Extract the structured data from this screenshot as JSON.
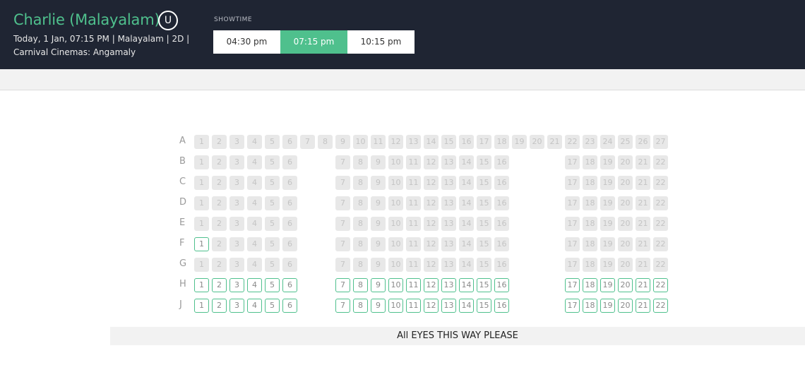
{
  "header": {
    "title": "Charlie (Malayalam)",
    "certificate": "U",
    "info_line1": "Today, 1 Jan, 07:15 PM | Malayalam | 2D |",
    "info_line2": "Carnival Cinemas: Angamaly"
  },
  "showtimes": {
    "label": "SHOWTIME",
    "times": [
      "04:30 pm",
      "07:15 pm",
      "10:15 pm"
    ],
    "selected": "07:15 pm"
  },
  "seating": {
    "rows": [
      {
        "label": "A",
        "seats": [
          {
            "n": "1",
            "s": "booked"
          },
          {
            "n": "2",
            "s": "booked"
          },
          {
            "n": "3",
            "s": "booked"
          },
          {
            "n": "4",
            "s": "booked"
          },
          {
            "n": "5",
            "s": "booked"
          },
          {
            "n": "6",
            "s": "booked"
          },
          {
            "n": "7",
            "s": "booked"
          },
          {
            "n": "8",
            "s": "booked"
          },
          {
            "n": "9",
            "s": "booked"
          },
          {
            "n": "10",
            "s": "booked"
          },
          {
            "n": "11",
            "s": "booked"
          },
          {
            "n": "12",
            "s": "booked"
          },
          {
            "n": "13",
            "s": "booked"
          },
          {
            "n": "14",
            "s": "booked"
          },
          {
            "n": "15",
            "s": "booked"
          },
          {
            "n": "16",
            "s": "booked"
          },
          {
            "n": "17",
            "s": "booked"
          },
          {
            "n": "18",
            "s": "booked"
          },
          {
            "n": "19",
            "s": "booked"
          },
          {
            "n": "20",
            "s": "booked"
          },
          {
            "n": "21",
            "s": "booked"
          },
          {
            "n": "22",
            "s": "booked"
          },
          {
            "n": "23",
            "s": "booked"
          },
          {
            "n": "24",
            "s": "booked"
          },
          {
            "n": "25",
            "s": "booked"
          },
          {
            "n": "26",
            "s": "booked"
          },
          {
            "n": "27",
            "s": "booked"
          }
        ]
      },
      {
        "label": "B",
        "seats": [
          {
            "n": "1",
            "s": "booked"
          },
          {
            "n": "2",
            "s": "booked"
          },
          {
            "n": "3",
            "s": "booked"
          },
          {
            "n": "4",
            "s": "booked"
          },
          {
            "n": "5",
            "s": "booked"
          },
          {
            "n": "6",
            "s": "booked"
          },
          {
            "n": "7",
            "s": "booked"
          },
          {
            "n": "8",
            "s": "booked"
          },
          {
            "n": "9",
            "s": "booked"
          },
          {
            "n": "10",
            "s": "booked"
          },
          {
            "n": "11",
            "s": "booked"
          },
          {
            "n": "12",
            "s": "booked"
          },
          {
            "n": "13",
            "s": "booked"
          },
          {
            "n": "14",
            "s": "booked"
          },
          {
            "n": "15",
            "s": "booked"
          },
          {
            "n": "16",
            "s": "booked"
          },
          {
            "n": "17",
            "s": "booked"
          },
          {
            "n": "18",
            "s": "booked"
          },
          {
            "n": "19",
            "s": "booked"
          },
          {
            "n": "20",
            "s": "booked"
          },
          {
            "n": "21",
            "s": "booked"
          },
          {
            "n": "22",
            "s": "booked"
          }
        ]
      },
      {
        "label": "C",
        "seats": [
          {
            "n": "1",
            "s": "booked"
          },
          {
            "n": "2",
            "s": "booked"
          },
          {
            "n": "3",
            "s": "booked"
          },
          {
            "n": "4",
            "s": "booked"
          },
          {
            "n": "5",
            "s": "booked"
          },
          {
            "n": "6",
            "s": "booked"
          },
          {
            "n": "7",
            "s": "booked"
          },
          {
            "n": "8",
            "s": "booked"
          },
          {
            "n": "9",
            "s": "booked"
          },
          {
            "n": "10",
            "s": "booked"
          },
          {
            "n": "11",
            "s": "booked"
          },
          {
            "n": "12",
            "s": "booked"
          },
          {
            "n": "13",
            "s": "booked"
          },
          {
            "n": "14",
            "s": "booked"
          },
          {
            "n": "15",
            "s": "booked"
          },
          {
            "n": "16",
            "s": "booked"
          },
          {
            "n": "17",
            "s": "booked"
          },
          {
            "n": "18",
            "s": "booked"
          },
          {
            "n": "19",
            "s": "booked"
          },
          {
            "n": "20",
            "s": "booked"
          },
          {
            "n": "21",
            "s": "booked"
          },
          {
            "n": "22",
            "s": "booked"
          }
        ]
      },
      {
        "label": "D",
        "seats": [
          {
            "n": "1",
            "s": "booked"
          },
          {
            "n": "2",
            "s": "booked"
          },
          {
            "n": "3",
            "s": "booked"
          },
          {
            "n": "4",
            "s": "booked"
          },
          {
            "n": "5",
            "s": "booked"
          },
          {
            "n": "6",
            "s": "booked"
          },
          {
            "n": "7",
            "s": "booked"
          },
          {
            "n": "8",
            "s": "booked"
          },
          {
            "n": "9",
            "s": "booked"
          },
          {
            "n": "10",
            "s": "booked"
          },
          {
            "n": "11",
            "s": "booked"
          },
          {
            "n": "12",
            "s": "booked"
          },
          {
            "n": "13",
            "s": "booked"
          },
          {
            "n": "14",
            "s": "booked"
          },
          {
            "n": "15",
            "s": "booked"
          },
          {
            "n": "16",
            "s": "booked"
          },
          {
            "n": "17",
            "s": "booked"
          },
          {
            "n": "18",
            "s": "booked"
          },
          {
            "n": "19",
            "s": "booked"
          },
          {
            "n": "20",
            "s": "booked"
          },
          {
            "n": "21",
            "s": "booked"
          },
          {
            "n": "22",
            "s": "booked"
          }
        ]
      },
      {
        "label": "E",
        "seats": [
          {
            "n": "1",
            "s": "booked"
          },
          {
            "n": "2",
            "s": "booked"
          },
          {
            "n": "3",
            "s": "booked"
          },
          {
            "n": "4",
            "s": "booked"
          },
          {
            "n": "5",
            "s": "booked"
          },
          {
            "n": "6",
            "s": "booked"
          },
          {
            "n": "7",
            "s": "booked"
          },
          {
            "n": "8",
            "s": "booked"
          },
          {
            "n": "9",
            "s": "booked"
          },
          {
            "n": "10",
            "s": "booked"
          },
          {
            "n": "11",
            "s": "booked"
          },
          {
            "n": "12",
            "s": "booked"
          },
          {
            "n": "13",
            "s": "booked"
          },
          {
            "n": "14",
            "s": "booked"
          },
          {
            "n": "15",
            "s": "booked"
          },
          {
            "n": "16",
            "s": "booked"
          },
          {
            "n": "17",
            "s": "booked"
          },
          {
            "n": "18",
            "s": "booked"
          },
          {
            "n": "19",
            "s": "booked"
          },
          {
            "n": "20",
            "s": "booked"
          },
          {
            "n": "21",
            "s": "booked"
          },
          {
            "n": "22",
            "s": "booked"
          }
        ]
      },
      {
        "label": "F",
        "seats": [
          {
            "n": "1",
            "s": "available"
          },
          {
            "n": "2",
            "s": "booked"
          },
          {
            "n": "3",
            "s": "booked"
          },
          {
            "n": "4",
            "s": "booked"
          },
          {
            "n": "5",
            "s": "booked"
          },
          {
            "n": "6",
            "s": "booked"
          },
          {
            "n": "7",
            "s": "booked"
          },
          {
            "n": "8",
            "s": "booked"
          },
          {
            "n": "9",
            "s": "booked"
          },
          {
            "n": "10",
            "s": "booked"
          },
          {
            "n": "11",
            "s": "booked"
          },
          {
            "n": "12",
            "s": "booked"
          },
          {
            "n": "13",
            "s": "booked"
          },
          {
            "n": "14",
            "s": "booked"
          },
          {
            "n": "15",
            "s": "booked"
          },
          {
            "n": "16",
            "s": "booked"
          },
          {
            "n": "17",
            "s": "booked"
          },
          {
            "n": "18",
            "s": "booked"
          },
          {
            "n": "19",
            "s": "booked"
          },
          {
            "n": "20",
            "s": "booked"
          },
          {
            "n": "21",
            "s": "booked"
          },
          {
            "n": "22",
            "s": "booked"
          }
        ]
      },
      {
        "label": "G",
        "seats": [
          {
            "n": "1",
            "s": "booked"
          },
          {
            "n": "2",
            "s": "booked"
          },
          {
            "n": "3",
            "s": "booked"
          },
          {
            "n": "4",
            "s": "booked"
          },
          {
            "n": "5",
            "s": "booked"
          },
          {
            "n": "6",
            "s": "booked"
          },
          {
            "n": "7",
            "s": "booked"
          },
          {
            "n": "8",
            "s": "booked"
          },
          {
            "n": "9",
            "s": "booked"
          },
          {
            "n": "10",
            "s": "booked"
          },
          {
            "n": "11",
            "s": "booked"
          },
          {
            "n": "12",
            "s": "booked"
          },
          {
            "n": "13",
            "s": "booked"
          },
          {
            "n": "14",
            "s": "booked"
          },
          {
            "n": "15",
            "s": "booked"
          },
          {
            "n": "16",
            "s": "booked"
          },
          {
            "n": "17",
            "s": "booked"
          },
          {
            "n": "18",
            "s": "booked"
          },
          {
            "n": "19",
            "s": "booked"
          },
          {
            "n": "20",
            "s": "booked"
          },
          {
            "n": "21",
            "s": "booked"
          },
          {
            "n": "22",
            "s": "booked"
          }
        ]
      },
      {
        "label": "H",
        "seats": [
          {
            "n": "1",
            "s": "available"
          },
          {
            "n": "2",
            "s": "available"
          },
          {
            "n": "3",
            "s": "available"
          },
          {
            "n": "4",
            "s": "available"
          },
          {
            "n": "5",
            "s": "available"
          },
          {
            "n": "6",
            "s": "available"
          },
          {
            "n": "7",
            "s": "available"
          },
          {
            "n": "8",
            "s": "available"
          },
          {
            "n": "9",
            "s": "available"
          },
          {
            "n": "10",
            "s": "available"
          },
          {
            "n": "11",
            "s": "available"
          },
          {
            "n": "12",
            "s": "available"
          },
          {
            "n": "13",
            "s": "available"
          },
          {
            "n": "14",
            "s": "available"
          },
          {
            "n": "15",
            "s": "available"
          },
          {
            "n": "16",
            "s": "available"
          },
          {
            "n": "17",
            "s": "available"
          },
          {
            "n": "18",
            "s": "available"
          },
          {
            "n": "19",
            "s": "available"
          },
          {
            "n": "20",
            "s": "available"
          },
          {
            "n": "21",
            "s": "available"
          },
          {
            "n": "22",
            "s": "available"
          }
        ]
      },
      {
        "label": "J",
        "seats": [
          {
            "n": "1",
            "s": "available"
          },
          {
            "n": "2",
            "s": "available"
          },
          {
            "n": "3",
            "s": "available"
          },
          {
            "n": "4",
            "s": "available"
          },
          {
            "n": "5",
            "s": "available"
          },
          {
            "n": "6",
            "s": "available"
          },
          {
            "n": "7",
            "s": "available"
          },
          {
            "n": "8",
            "s": "available"
          },
          {
            "n": "9",
            "s": "available"
          },
          {
            "n": "10",
            "s": "available"
          },
          {
            "n": "11",
            "s": "available"
          },
          {
            "n": "12",
            "s": "available"
          },
          {
            "n": "13",
            "s": "available"
          },
          {
            "n": "14",
            "s": "available"
          },
          {
            "n": "15",
            "s": "available"
          },
          {
            "n": "16",
            "s": "available"
          },
          {
            "n": "17",
            "s": "available"
          },
          {
            "n": "18",
            "s": "available"
          },
          {
            "n": "19",
            "s": "available"
          },
          {
            "n": "20",
            "s": "available"
          },
          {
            "n": "21",
            "s": "available"
          },
          {
            "n": "22",
            "s": "available"
          }
        ]
      }
    ]
  },
  "screen": {
    "label": "All EYES THIS WAY PLEASE"
  },
  "colors": {
    "header_bg": "#1f2533",
    "accent": "#4fc08d",
    "booked_seat": "#e8e8e8"
  }
}
